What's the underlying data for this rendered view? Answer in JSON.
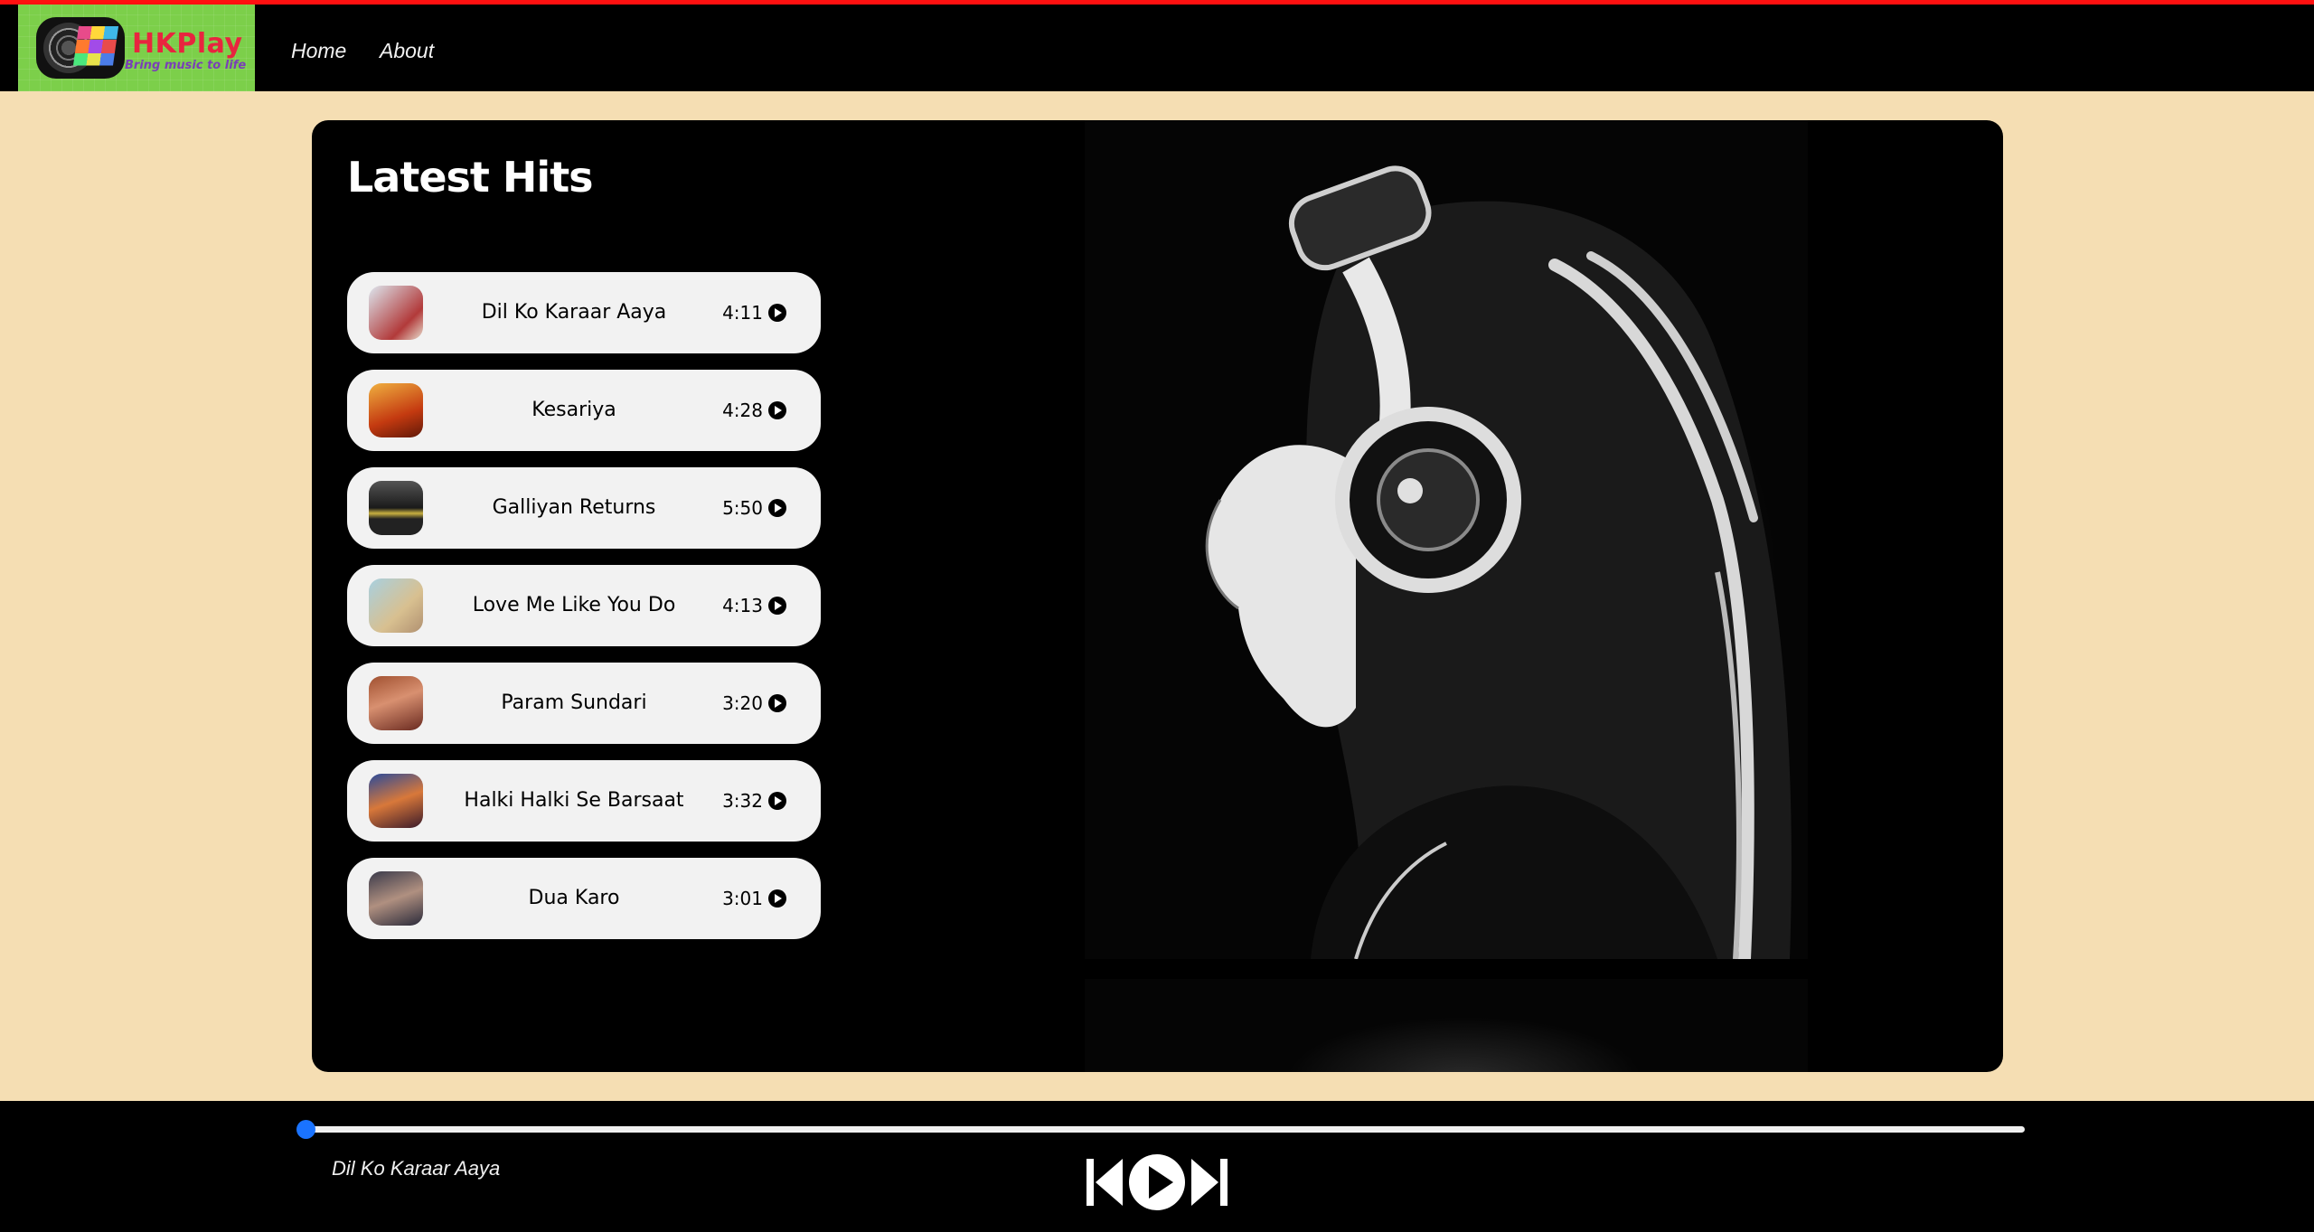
{
  "brand": {
    "name": "HKPlay",
    "tagline": "Bring music to life"
  },
  "nav": {
    "links": [
      {
        "label": "Home"
      },
      {
        "label": "About"
      }
    ]
  },
  "main": {
    "title": "Latest Hits",
    "songs": [
      {
        "name": "Dil Ko Karaar Aaya",
        "duration": "4:11",
        "thumb_color": "#c8d8e8"
      },
      {
        "name": "Kesariya",
        "duration": "4:28",
        "thumb_color": "#c44a1a"
      },
      {
        "name": "Galliyan Returns",
        "duration": "5:50",
        "thumb_color": "#3a3a3a"
      },
      {
        "name": "Love Me Like You Do",
        "duration": "4:13",
        "thumb_color": "#b8cfd8"
      },
      {
        "name": "Param Sundari",
        "duration": "3:20",
        "thumb_color": "#8a4a3a"
      },
      {
        "name": "Halki Halki Se Barsaat",
        "duration": "3:32",
        "thumb_color": "#5a3a6a"
      },
      {
        "name": "Dua Karo",
        "duration": "3:01",
        "thumb_color": "#4a4a5a"
      }
    ]
  },
  "player": {
    "now_playing": "Dil Ko Karaar Aaya",
    "progress": 0,
    "accent_color": "#1a73ff"
  },
  "colors": {
    "page_background": "#f5deb3",
    "top_bar_accent": "#ff1010"
  }
}
